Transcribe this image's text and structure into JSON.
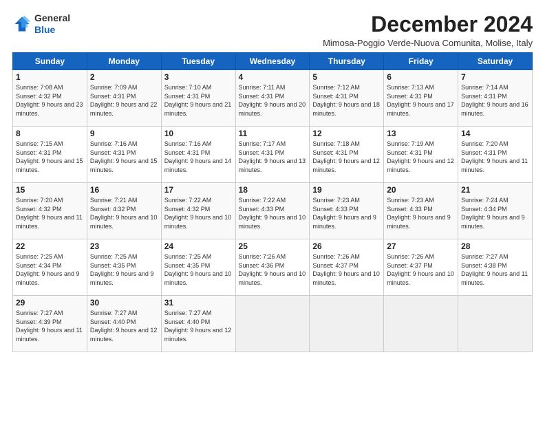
{
  "header": {
    "logo_line1": "General",
    "logo_line2": "Blue",
    "month_title": "December 2024",
    "subtitle": "Mimosa-Poggio Verde-Nuova Comunita, Molise, Italy"
  },
  "days_of_week": [
    "Sunday",
    "Monday",
    "Tuesday",
    "Wednesday",
    "Thursday",
    "Friday",
    "Saturday"
  ],
  "weeks": [
    [
      {
        "day": "1",
        "sunrise": "Sunrise: 7:08 AM",
        "sunset": "Sunset: 4:32 PM",
        "daylight": "Daylight: 9 hours and 23 minutes."
      },
      {
        "day": "2",
        "sunrise": "Sunrise: 7:09 AM",
        "sunset": "Sunset: 4:31 PM",
        "daylight": "Daylight: 9 hours and 22 minutes."
      },
      {
        "day": "3",
        "sunrise": "Sunrise: 7:10 AM",
        "sunset": "Sunset: 4:31 PM",
        "daylight": "Daylight: 9 hours and 21 minutes."
      },
      {
        "day": "4",
        "sunrise": "Sunrise: 7:11 AM",
        "sunset": "Sunset: 4:31 PM",
        "daylight": "Daylight: 9 hours and 20 minutes."
      },
      {
        "day": "5",
        "sunrise": "Sunrise: 7:12 AM",
        "sunset": "Sunset: 4:31 PM",
        "daylight": "Daylight: 9 hours and 18 minutes."
      },
      {
        "day": "6",
        "sunrise": "Sunrise: 7:13 AM",
        "sunset": "Sunset: 4:31 PM",
        "daylight": "Daylight: 9 hours and 17 minutes."
      },
      {
        "day": "7",
        "sunrise": "Sunrise: 7:14 AM",
        "sunset": "Sunset: 4:31 PM",
        "daylight": "Daylight: 9 hours and 16 minutes."
      }
    ],
    [
      {
        "day": "8",
        "sunrise": "Sunrise: 7:15 AM",
        "sunset": "Sunset: 4:31 PM",
        "daylight": "Daylight: 9 hours and 15 minutes."
      },
      {
        "day": "9",
        "sunrise": "Sunrise: 7:16 AM",
        "sunset": "Sunset: 4:31 PM",
        "daylight": "Daylight: 9 hours and 15 minutes."
      },
      {
        "day": "10",
        "sunrise": "Sunrise: 7:16 AM",
        "sunset": "Sunset: 4:31 PM",
        "daylight": "Daylight: 9 hours and 14 minutes."
      },
      {
        "day": "11",
        "sunrise": "Sunrise: 7:17 AM",
        "sunset": "Sunset: 4:31 PM",
        "daylight": "Daylight: 9 hours and 13 minutes."
      },
      {
        "day": "12",
        "sunrise": "Sunrise: 7:18 AM",
        "sunset": "Sunset: 4:31 PM",
        "daylight": "Daylight: 9 hours and 12 minutes."
      },
      {
        "day": "13",
        "sunrise": "Sunrise: 7:19 AM",
        "sunset": "Sunset: 4:31 PM",
        "daylight": "Daylight: 9 hours and 12 minutes."
      },
      {
        "day": "14",
        "sunrise": "Sunrise: 7:20 AM",
        "sunset": "Sunset: 4:31 PM",
        "daylight": "Daylight: 9 hours and 11 minutes."
      }
    ],
    [
      {
        "day": "15",
        "sunrise": "Sunrise: 7:20 AM",
        "sunset": "Sunset: 4:32 PM",
        "daylight": "Daylight: 9 hours and 11 minutes."
      },
      {
        "day": "16",
        "sunrise": "Sunrise: 7:21 AM",
        "sunset": "Sunset: 4:32 PM",
        "daylight": "Daylight: 9 hours and 10 minutes."
      },
      {
        "day": "17",
        "sunrise": "Sunrise: 7:22 AM",
        "sunset": "Sunset: 4:32 PM",
        "daylight": "Daylight: 9 hours and 10 minutes."
      },
      {
        "day": "18",
        "sunrise": "Sunrise: 7:22 AM",
        "sunset": "Sunset: 4:33 PM",
        "daylight": "Daylight: 9 hours and 10 minutes."
      },
      {
        "day": "19",
        "sunrise": "Sunrise: 7:23 AM",
        "sunset": "Sunset: 4:33 PM",
        "daylight": "Daylight: 9 hours and 9 minutes."
      },
      {
        "day": "20",
        "sunrise": "Sunrise: 7:23 AM",
        "sunset": "Sunset: 4:33 PM",
        "daylight": "Daylight: 9 hours and 9 minutes."
      },
      {
        "day": "21",
        "sunrise": "Sunrise: 7:24 AM",
        "sunset": "Sunset: 4:34 PM",
        "daylight": "Daylight: 9 hours and 9 minutes."
      }
    ],
    [
      {
        "day": "22",
        "sunrise": "Sunrise: 7:25 AM",
        "sunset": "Sunset: 4:34 PM",
        "daylight": "Daylight: 9 hours and 9 minutes."
      },
      {
        "day": "23",
        "sunrise": "Sunrise: 7:25 AM",
        "sunset": "Sunset: 4:35 PM",
        "daylight": "Daylight: 9 hours and 9 minutes."
      },
      {
        "day": "24",
        "sunrise": "Sunrise: 7:25 AM",
        "sunset": "Sunset: 4:35 PM",
        "daylight": "Daylight: 9 hours and 10 minutes."
      },
      {
        "day": "25",
        "sunrise": "Sunrise: 7:26 AM",
        "sunset": "Sunset: 4:36 PM",
        "daylight": "Daylight: 9 hours and 10 minutes."
      },
      {
        "day": "26",
        "sunrise": "Sunrise: 7:26 AM",
        "sunset": "Sunset: 4:37 PM",
        "daylight": "Daylight: 9 hours and 10 minutes."
      },
      {
        "day": "27",
        "sunrise": "Sunrise: 7:26 AM",
        "sunset": "Sunset: 4:37 PM",
        "daylight": "Daylight: 9 hours and 10 minutes."
      },
      {
        "day": "28",
        "sunrise": "Sunrise: 7:27 AM",
        "sunset": "Sunset: 4:38 PM",
        "daylight": "Daylight: 9 hours and 11 minutes."
      }
    ],
    [
      {
        "day": "29",
        "sunrise": "Sunrise: 7:27 AM",
        "sunset": "Sunset: 4:39 PM",
        "daylight": "Daylight: 9 hours and 11 minutes."
      },
      {
        "day": "30",
        "sunrise": "Sunrise: 7:27 AM",
        "sunset": "Sunset: 4:40 PM",
        "daylight": "Daylight: 9 hours and 12 minutes."
      },
      {
        "day": "31",
        "sunrise": "Sunrise: 7:27 AM",
        "sunset": "Sunset: 4:40 PM",
        "daylight": "Daylight: 9 hours and 12 minutes."
      },
      null,
      null,
      null,
      null
    ]
  ]
}
